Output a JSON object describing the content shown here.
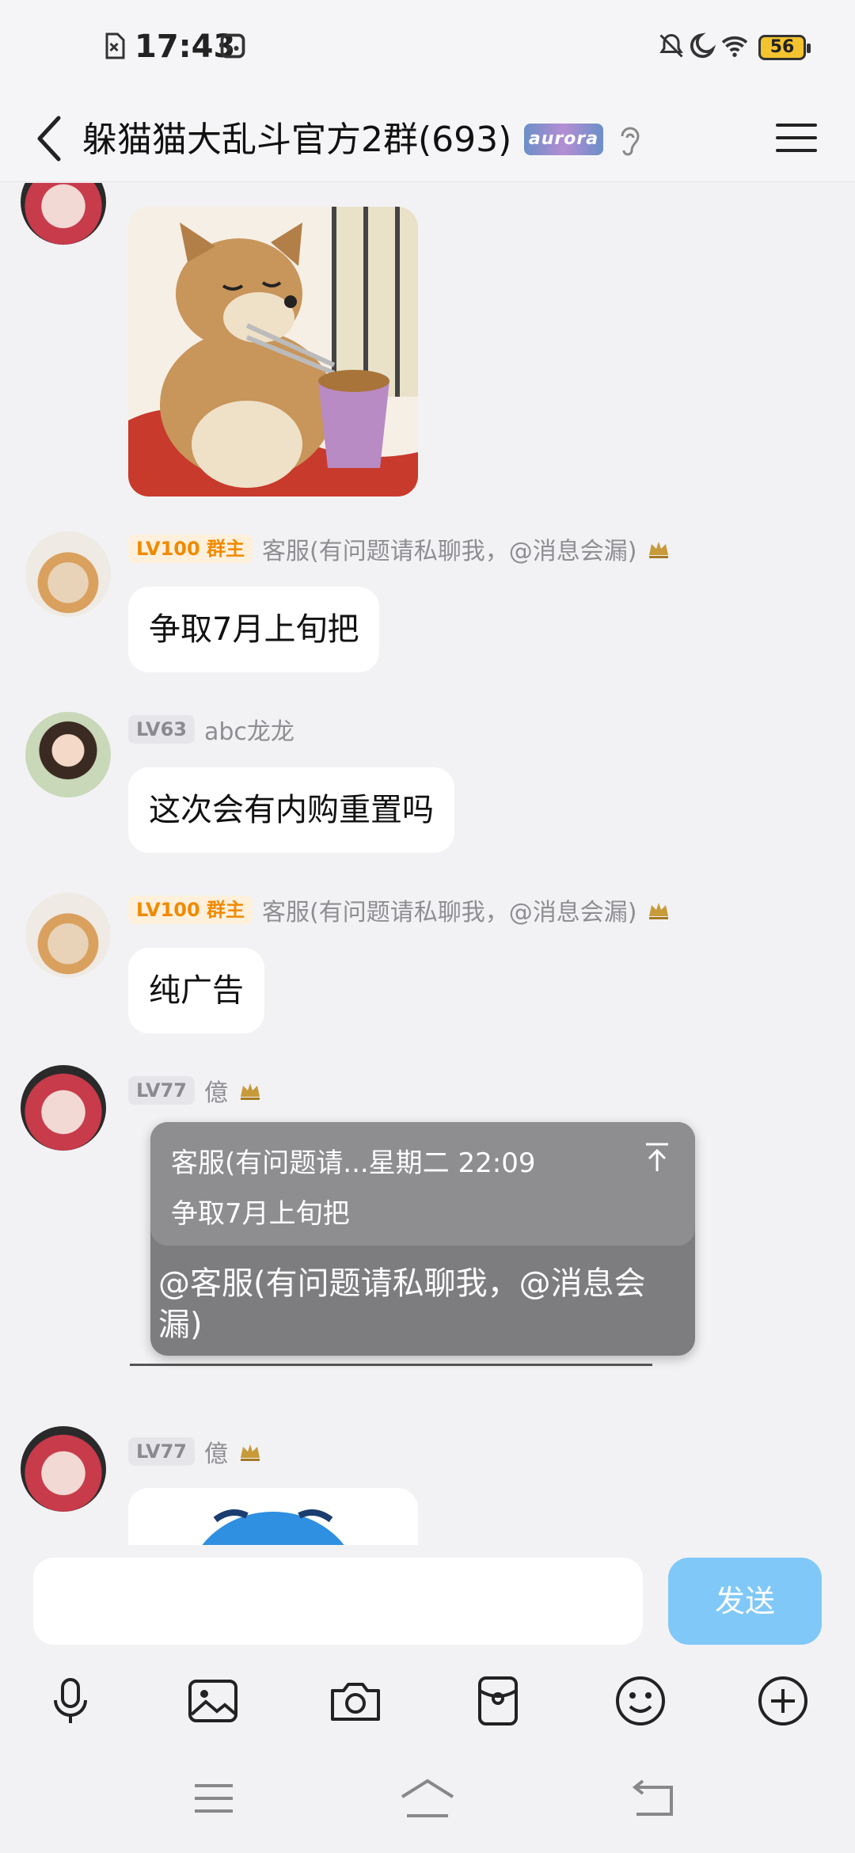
{
  "status_bar": {
    "time": "17:43",
    "battery": "56",
    "icons": [
      "sim-off-icon",
      "screen-icon",
      "mute-icon",
      "moon-icon",
      "wifi-icon",
      "battery-icon"
    ]
  },
  "title_bar": {
    "title": "躲猫猫大乱斗官方2群(693)",
    "badge": "aurora"
  },
  "messages": [
    {
      "sender": "客服(有问题请私聊我，@消息会漏)",
      "level": "LV100",
      "role": "群主",
      "text": "争取7月上旬把"
    },
    {
      "sender": "abc龙龙",
      "level": "LV63",
      "text": "这次会有内购重置吗"
    },
    {
      "sender": "客服(有问题请私聊我，@消息会漏)",
      "level": "LV100",
      "role": "群主",
      "text": "纯广告"
    },
    {
      "sender": "億",
      "level": "LV77",
      "reply": {
        "quote_meta": "客服(有问题请...星期二  22:09",
        "quote_text": "争取7月上旬把",
        "text": "@客服(有问题请私聊我，@消息会漏)"
      }
    },
    {
      "sender": "億",
      "level": "LV77"
    }
  ],
  "input": {
    "value": "",
    "send_label": "发送"
  },
  "colors": {
    "owner_badge": "#f08a00",
    "send_button": "#80c8f8",
    "reply_card": "#7d7d80"
  }
}
